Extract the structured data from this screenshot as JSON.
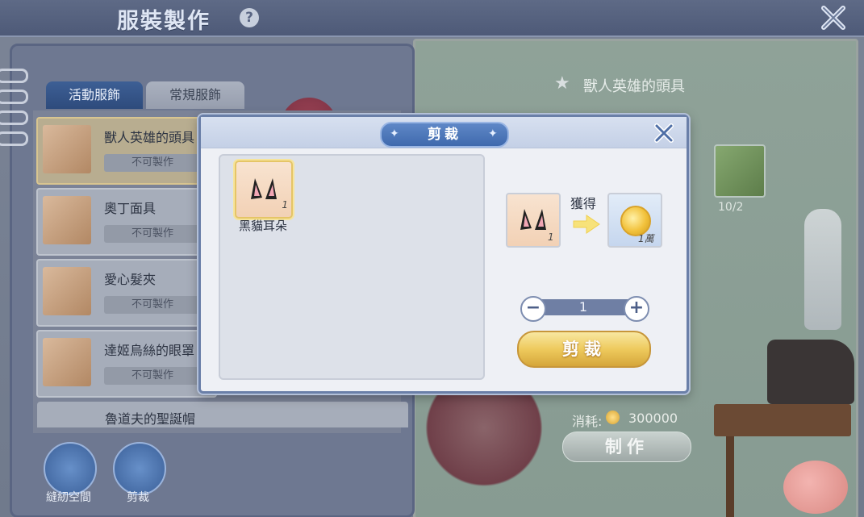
{
  "header": {
    "title": "服裝製作",
    "help": "?"
  },
  "tabs": [
    {
      "label": "活動服飾",
      "active": true
    },
    {
      "label": "常規服飾",
      "active": false
    }
  ],
  "items": [
    {
      "name": "獸人英雄的頭具",
      "status": "不可製作"
    },
    {
      "name": "奧丁面具",
      "status": "不可製作"
    },
    {
      "name": "愛心髮夾",
      "status": "不可製作"
    },
    {
      "name": "達姬烏絲的眼罩",
      "status": "不可製作"
    },
    {
      "name": "魯道夫的聖誕帽"
    }
  ],
  "nav": [
    {
      "label": "縫紉空間"
    },
    {
      "label": "剪裁"
    }
  ],
  "board": {
    "item_name": "獸人英雄的頭具",
    "count": "10/2",
    "cost_label": "消耗:",
    "cost_value": "300000",
    "make_label": "制作"
  },
  "dialog": {
    "title": "剪裁",
    "source": {
      "name": "黑貓耳朵",
      "qty": "1"
    },
    "input_qty": "1",
    "obtain_label": "獲得",
    "output_qty": "1萬",
    "quantity": "1",
    "minus": "−",
    "plus": "+",
    "cut_label": "剪裁"
  },
  "colors": {
    "accent": "#3f69ad",
    "gold": "#eeca5d",
    "panel": "#eef0f5"
  }
}
